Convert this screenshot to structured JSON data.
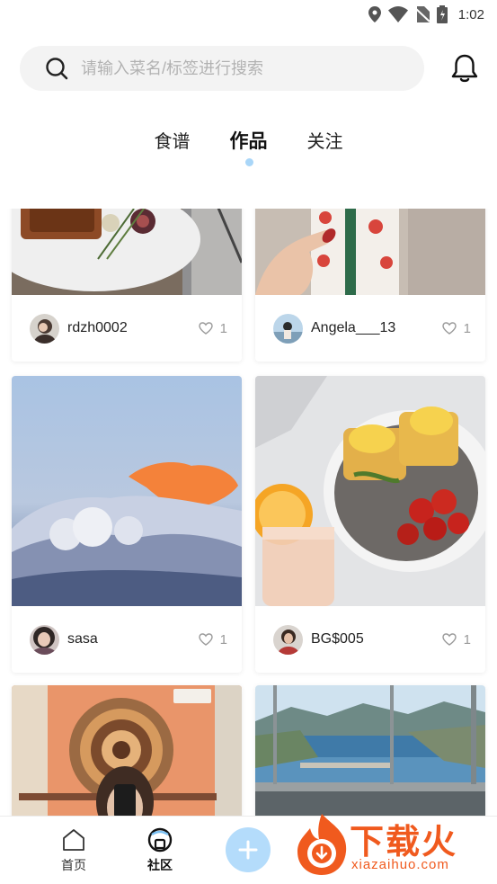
{
  "status_bar": {
    "time": "1:02"
  },
  "search": {
    "placeholder": "请输入菜名/标签进行搜索"
  },
  "tabs": [
    {
      "label": "食谱",
      "active": false
    },
    {
      "label": "作品",
      "active": true
    },
    {
      "label": "关注",
      "active": false
    }
  ],
  "cards": [
    {
      "author": "rdzh0002",
      "likes": "1",
      "image": "steak-plate"
    },
    {
      "author": "Angela___13",
      "likes": "1",
      "image": "starbucks-cup"
    },
    {
      "author": "sasa",
      "likes": "1",
      "image": "sky-clouds"
    },
    {
      "author": "BG$005",
      "likes": "1",
      "image": "eggs-benedict"
    },
    {
      "author": "",
      "likes": "",
      "image": "mandala-wall-selfie"
    },
    {
      "author": "",
      "likes": "",
      "image": "harbor-view"
    }
  ],
  "bottom_nav": {
    "home_label": "首页",
    "community_label": "社区"
  },
  "watermark": {
    "brand": "下载火",
    "domain": "xiazaihuo.com"
  },
  "colors": {
    "accent": "#a9d6f8",
    "fab": "#b4dcfb",
    "watermark": "#f05a1e"
  }
}
